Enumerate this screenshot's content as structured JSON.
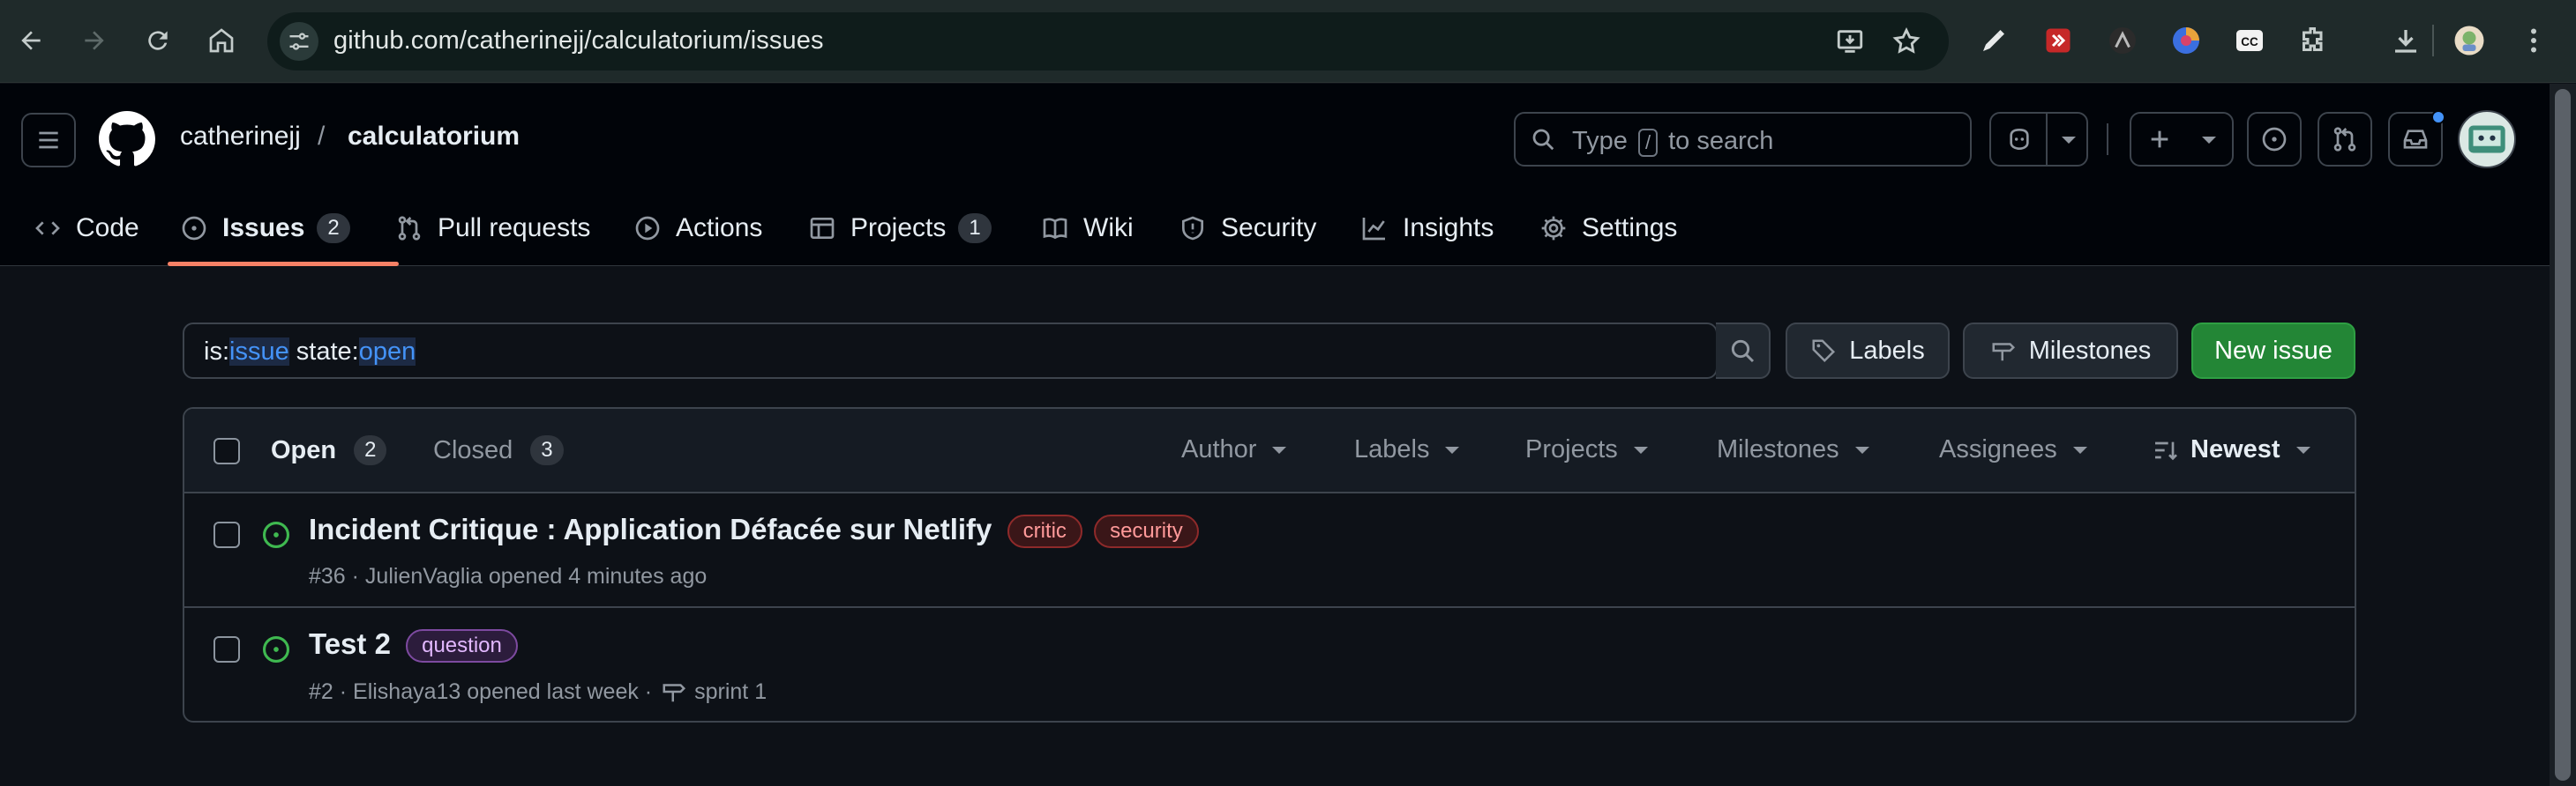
{
  "browser": {
    "url": "github.com/catherinejj/calculatorium/issues"
  },
  "header": {
    "owner": "catherinejj",
    "separator": "/",
    "repo": "calculatorium",
    "search_prefix": "Type",
    "search_key": "/",
    "search_suffix": "to search"
  },
  "repo_nav": {
    "tabs": [
      {
        "label": "Code",
        "icon": "code-icon"
      },
      {
        "label": "Issues",
        "icon": "issue-opened-icon",
        "count": "2",
        "active": true
      },
      {
        "label": "Pull requests",
        "icon": "git-pull-request-icon"
      },
      {
        "label": "Actions",
        "icon": "play-icon"
      },
      {
        "label": "Projects",
        "icon": "table-icon",
        "count": "1"
      },
      {
        "label": "Wiki",
        "icon": "book-icon"
      },
      {
        "label": "Security",
        "icon": "shield-icon"
      },
      {
        "label": "Insights",
        "icon": "graph-icon"
      },
      {
        "label": "Settings",
        "icon": "gear-icon"
      }
    ]
  },
  "toolbar": {
    "filter_parts": [
      {
        "text": "is:",
        "kw": false
      },
      {
        "text": "issue",
        "kw": true
      },
      {
        "text": " state:",
        "kw": false
      },
      {
        "text": "open",
        "kw": true
      }
    ],
    "labels_button": "Labels",
    "milestones_button": "Milestones",
    "new_issue_button": "New issue"
  },
  "list_header": {
    "open_label": "Open",
    "open_count": "2",
    "closed_label": "Closed",
    "closed_count": "3",
    "filters": [
      "Author",
      "Labels",
      "Projects",
      "Milestones",
      "Assignees"
    ],
    "sort_label": "Newest"
  },
  "issues": [
    {
      "title": "Incident Critique : Application Défacée sur Netlify",
      "labels": [
        {
          "name": "critic",
          "color": "#f85149"
        },
        {
          "name": "security",
          "color": "#f85149"
        }
      ],
      "meta": "#36 · JulienVaglia opened 4 minutes ago"
    },
    {
      "title": "Test 2",
      "labels": [
        {
          "name": "question",
          "color": "#d2a8ff"
        }
      ],
      "meta": "#2 · Elishaya13 opened last week ·",
      "milestone": "sprint 1"
    }
  ],
  "colors": {
    "accent_green": "#238636",
    "open_icon": "#3fb950",
    "tab_underline": "#f78166",
    "link_blue": "#4493f8"
  }
}
